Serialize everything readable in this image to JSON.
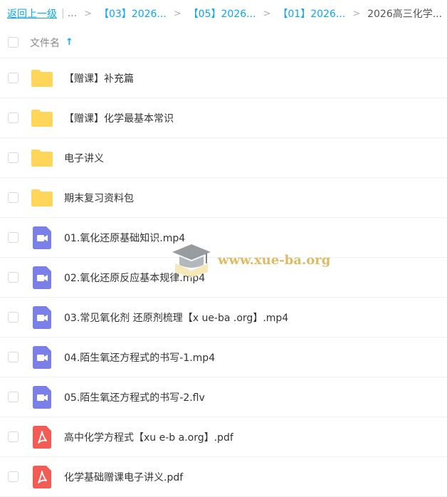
{
  "breadcrumb": {
    "back_label": "返回上一级",
    "sep": "|",
    "ellipsis": "...",
    "gt": ">",
    "links": [
      "【03】2026...",
      "【05】2026...",
      "【01】2026..."
    ],
    "current": "2026高三化学..."
  },
  "header": {
    "column_label": "文件名",
    "sort_arrow": "↑"
  },
  "files": [
    {
      "name": "【赠课】补充篇",
      "icon": "folder-icon"
    },
    {
      "name": "【赠课】化学最基本常识",
      "icon": "folder-icon"
    },
    {
      "name": "电子讲义",
      "icon": "folder-icon"
    },
    {
      "name": "期末复习资料包",
      "icon": "folder-icon"
    },
    {
      "name": "01.氧化还原基础知识.mp4",
      "icon": "video-file-icon"
    },
    {
      "name": "02.氧化还原反应基本规律.mp4",
      "icon": "video-file-icon"
    },
    {
      "name": "03.常见氧化剂 还原剂梳理【x ue-ba .org】.mp4",
      "icon": "video-file-icon"
    },
    {
      "name": "04.陌生氧还方程式的书写-1.mp4",
      "icon": "video-file-icon"
    },
    {
      "name": "05.陌生氧还方程式的书写-2.flv",
      "icon": "video-file-icon"
    },
    {
      "name": "高中化学方程式【xu e-b a.org】.pdf",
      "icon": "pdf-file-icon"
    },
    {
      "name": "化学基础赠课电子讲义.pdf",
      "icon": "pdf-file-icon"
    }
  ],
  "watermark": {
    "text": "www.xue-ba.org"
  },
  "colors": {
    "accent": "#06a7ff",
    "folder": "#ffd659",
    "video": "#7b7fe8",
    "pdf": "#f25c54"
  }
}
